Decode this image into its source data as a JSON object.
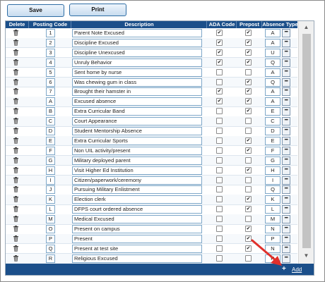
{
  "toolbar": {
    "save_label": "Save",
    "print_label": "Print"
  },
  "table": {
    "headers": {
      "delete": "Delete",
      "posting_code": "Posting Code",
      "description": "Description",
      "ada_code": "ADA Code",
      "prepost": "Prepost",
      "absence_type": "Absence Type"
    },
    "rows": [
      {
        "code": "1",
        "description": "Parent Note Excused",
        "ada": true,
        "prepost": true,
        "absence_type": "A"
      },
      {
        "code": "2",
        "description": "Discipline Excused",
        "ada": true,
        "prepost": true,
        "absence_type": "A"
      },
      {
        "code": "3",
        "description": "Discipline Unexcused",
        "ada": true,
        "prepost": true,
        "absence_type": "U"
      },
      {
        "code": "4",
        "description": "Unruly Behavior",
        "ada": true,
        "prepost": true,
        "absence_type": "Q"
      },
      {
        "code": "5",
        "description": "Sent home by nurse",
        "ada": false,
        "prepost": false,
        "absence_type": "A"
      },
      {
        "code": "6",
        "description": "Was chewing gum in class",
        "ada": false,
        "prepost": true,
        "absence_type": "Q"
      },
      {
        "code": "7",
        "description": "Brought their hamster in",
        "ada": true,
        "prepost": true,
        "absence_type": "A"
      },
      {
        "code": "A",
        "description": "Excused absence",
        "ada": true,
        "prepost": true,
        "absence_type": "A"
      },
      {
        "code": "B",
        "description": "Extra Curricular Band",
        "ada": false,
        "prepost": true,
        "absence_type": "E"
      },
      {
        "code": "C",
        "description": "Court Appearance",
        "ada": false,
        "prepost": false,
        "absence_type": "C"
      },
      {
        "code": "D",
        "description": "Student Mentorship Absence",
        "ada": false,
        "prepost": false,
        "absence_type": "D"
      },
      {
        "code": "E",
        "description": "Extra Curricular Sports",
        "ada": false,
        "prepost": true,
        "absence_type": "E"
      },
      {
        "code": "F",
        "description": "Non UIL activity/present",
        "ada": false,
        "prepost": true,
        "absence_type": "F"
      },
      {
        "code": "G",
        "description": "Military deployed parent",
        "ada": false,
        "prepost": false,
        "absence_type": "G"
      },
      {
        "code": "H",
        "description": "Visit Higher Ed Institution",
        "ada": false,
        "prepost": true,
        "absence_type": "H"
      },
      {
        "code": "I",
        "description": "Citizen/paperwork/ceremony",
        "ada": false,
        "prepost": false,
        "absence_type": "I"
      },
      {
        "code": "J",
        "description": "Pursuing Military Enlistment",
        "ada": false,
        "prepost": false,
        "absence_type": "Q"
      },
      {
        "code": "K",
        "description": "Election clerk",
        "ada": false,
        "prepost": true,
        "absence_type": "K"
      },
      {
        "code": "L",
        "description": "DFPS court ordered absence",
        "ada": false,
        "prepost": true,
        "absence_type": "L"
      },
      {
        "code": "M",
        "description": "Medical Excused",
        "ada": false,
        "prepost": false,
        "absence_type": "M"
      },
      {
        "code": "O",
        "description": "Present on campus",
        "ada": false,
        "prepost": true,
        "absence_type": "N"
      },
      {
        "code": "P",
        "description": "Present",
        "ada": false,
        "prepost": true,
        "absence_type": "P"
      },
      {
        "code": "Q",
        "description": "Present at test site",
        "ada": false,
        "prepost": true,
        "absence_type": "N"
      },
      {
        "code": "R",
        "description": "Religious Excused",
        "ada": false,
        "prepost": false,
        "absence_type": "R"
      }
    ]
  },
  "footer": {
    "add_label": "Add",
    "add_icon": "plus-icon"
  },
  "icons": {
    "delete": "trash-icon",
    "lookup": "ellipsis-icon",
    "scroll_up": "scroll-up-arrow-icon",
    "scroll_down": "scroll-down-arrow-icon",
    "pointer": "red-arrow-icon"
  },
  "colors": {
    "header_bg": "#1b4f8a",
    "header_text": "#ffffff",
    "field_border": "#7fa8c9",
    "arrow": "#e0302b"
  }
}
